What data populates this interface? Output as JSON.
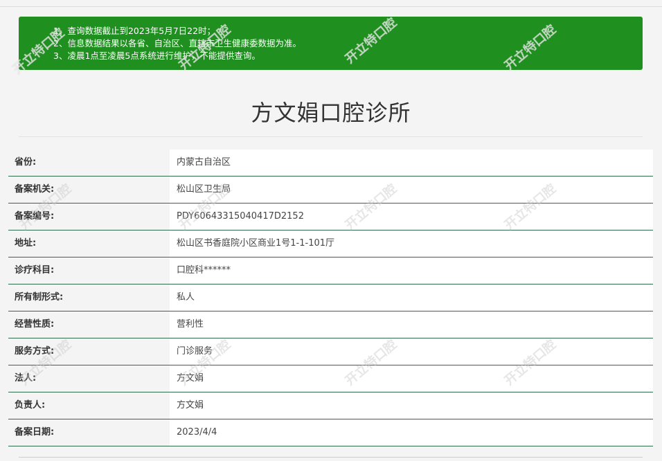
{
  "notice": {
    "lines": [
      "1、查询数据截止到2023年5月7日22时；",
      "2、信息数据结果以各省、自治区、直辖市卫生健康委数据为准。",
      "3、凌晨1点至凌晨5点系统进行维护，不能提供查询。"
    ]
  },
  "page": {
    "title": "方文娟口腔诊所"
  },
  "details": [
    {
      "label": "省份:",
      "value": "内蒙古自治区"
    },
    {
      "label": "备案机关:",
      "value": "松山区卫生局"
    },
    {
      "label": "备案编号:",
      "value": "PDY60643315040417D2152"
    },
    {
      "label": "地址:",
      "value": "松山区书香庭院小区商业1号1-1-101厅"
    },
    {
      "label": "诊疗科目:",
      "value": "口腔科******"
    },
    {
      "label": "所有制形式:",
      "value": "私人"
    },
    {
      "label": "经营性质:",
      "value": "营利性"
    },
    {
      "label": "服务方式:",
      "value": "门诊服务"
    },
    {
      "label": "法人:",
      "value": "方文娟"
    },
    {
      "label": "负责人:",
      "value": "方文娟"
    },
    {
      "label": "备案日期:",
      "value": "2023/4/4"
    }
  ],
  "watermark": {
    "text": "开立特口腔"
  },
  "colors": {
    "notice_bg": "#1f8f1f",
    "row_border": "#2f6b4a"
  }
}
